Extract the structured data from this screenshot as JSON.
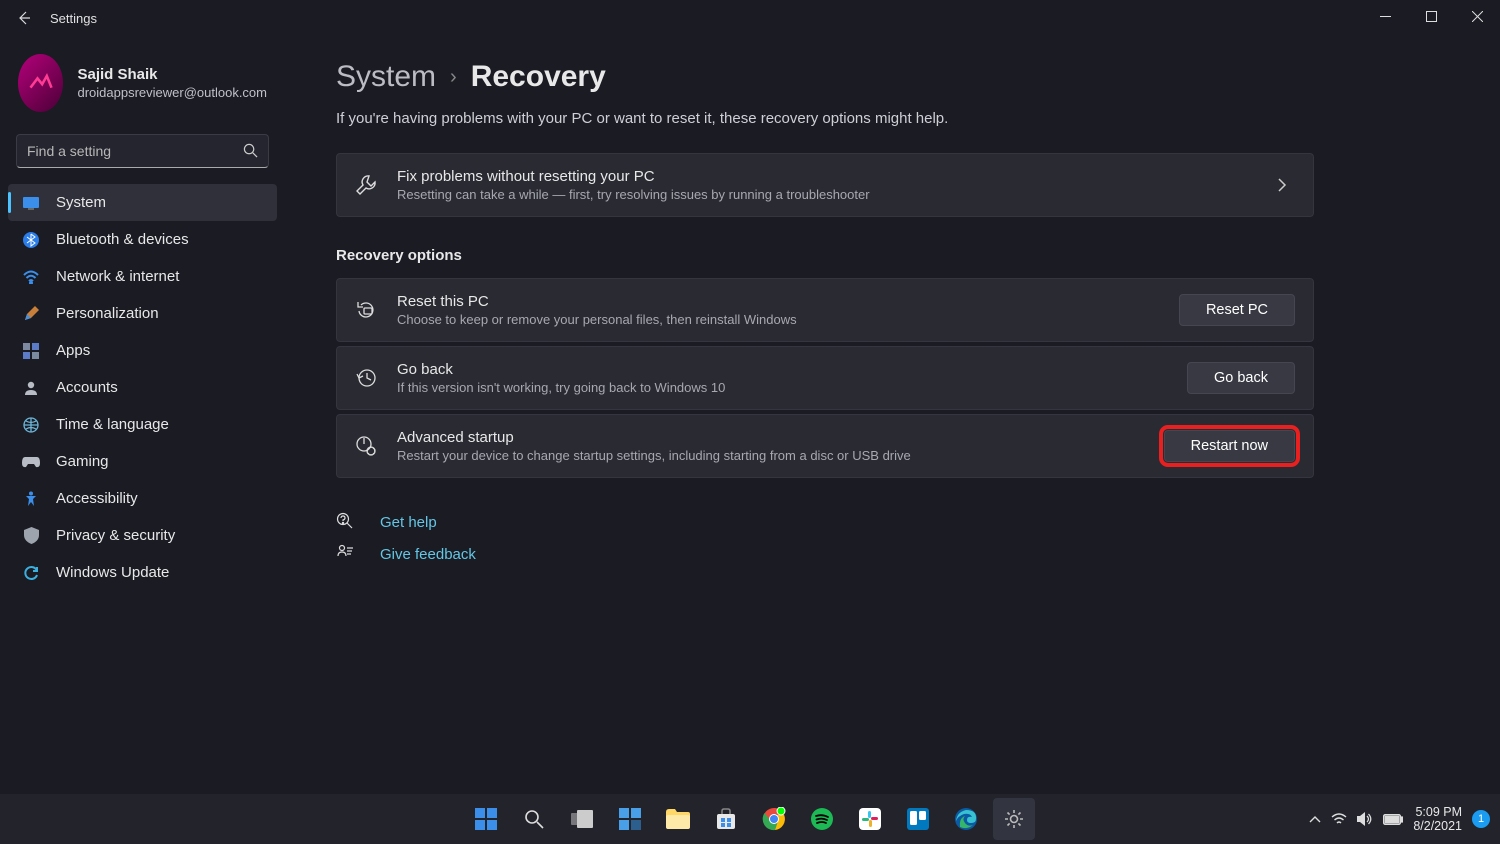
{
  "window": {
    "title": "Settings"
  },
  "user": {
    "name": "Sajid Shaik",
    "email": "droidappsreviewer@outlook.com"
  },
  "search": {
    "placeholder": "Find a setting"
  },
  "nav": {
    "items": [
      {
        "label": "System"
      },
      {
        "label": "Bluetooth & devices"
      },
      {
        "label": "Network & internet"
      },
      {
        "label": "Personalization"
      },
      {
        "label": "Apps"
      },
      {
        "label": "Accounts"
      },
      {
        "label": "Time & language"
      },
      {
        "label": "Gaming"
      },
      {
        "label": "Accessibility"
      },
      {
        "label": "Privacy & security"
      },
      {
        "label": "Windows Update"
      }
    ]
  },
  "main": {
    "breadcrumb_root": "System",
    "breadcrumb_page": "Recovery",
    "subtitle": "If you're having problems with your PC or want to reset it, these recovery options might help.",
    "troubleshooter": {
      "title": "Fix problems without resetting your PC",
      "desc": "Resetting can take a while — first, try resolving issues by running a troubleshooter"
    },
    "recovery_section": "Recovery options",
    "reset": {
      "title": "Reset this PC",
      "desc": "Choose to keep or remove your personal files, then reinstall Windows",
      "button": "Reset PC"
    },
    "goback": {
      "title": "Go back",
      "desc": "If this version isn't working, try going back to Windows 10",
      "button": "Go back"
    },
    "advanced": {
      "title": "Advanced startup",
      "desc": "Restart your device to change startup settings, including starting from a disc or USB drive",
      "button": "Restart now"
    },
    "help": "Get help",
    "feedback": "Give feedback"
  },
  "taskbar": {
    "time": "5:09 PM",
    "date": "8/2/2021",
    "notifications": "1"
  }
}
